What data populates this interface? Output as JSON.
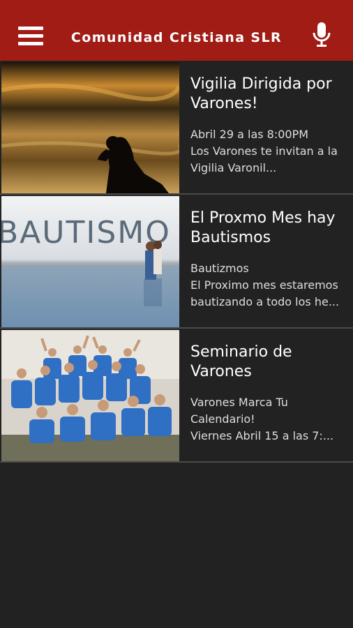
{
  "app": {
    "title": "Comunidad Cristiana SLR",
    "colors": {
      "header": "#a11c14",
      "background": "#222222"
    },
    "icons": {
      "menu": "hamburger-menu-icon",
      "voice": "microphone-icon"
    }
  },
  "posts": [
    {
      "title": "Vigilia Dirigida por Varones!",
      "line1": "Abril 29 a las 8:00PM",
      "line2": "Los Varones te invitan a la",
      "line3": "Vigilia Varonil..."
    },
    {
      "title": "El Proxmo Mes hay Bautismos",
      "image_text": "BAUTISMO",
      "line1": "Bautizmos",
      "line2": "El Proximo mes estaremos",
      "line3": "bautizando a todo los he..."
    },
    {
      "title": "Seminario de Varones",
      "line1": "Varones Marca Tu",
      "line2": "Calendario!",
      "line3": "Viernes Abril 15 a las 7:..."
    }
  ]
}
